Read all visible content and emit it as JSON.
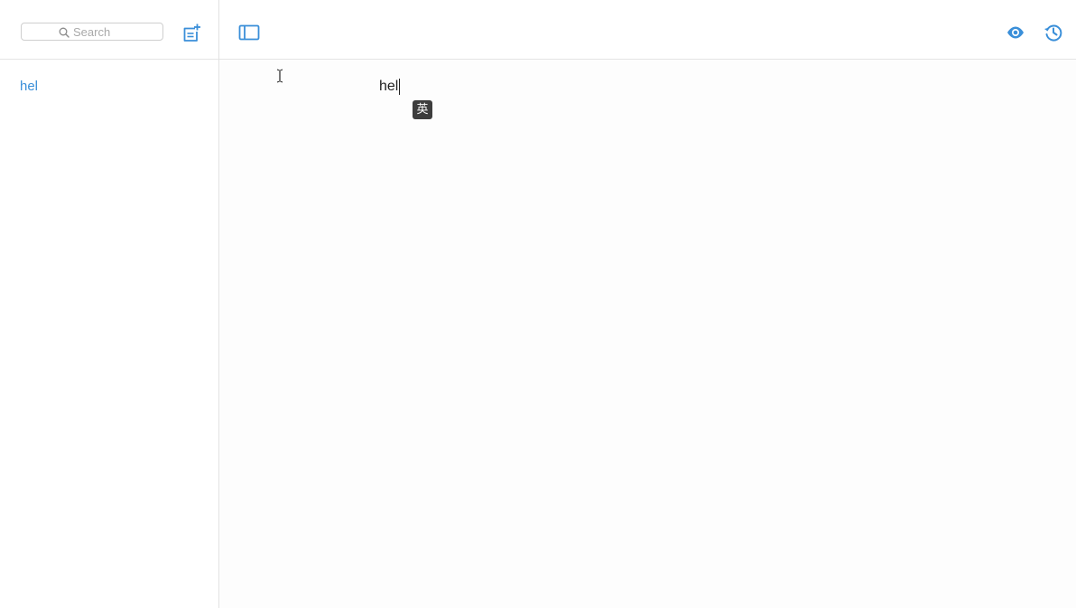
{
  "search": {
    "placeholder": "Search",
    "value": ""
  },
  "sidebar": {
    "notes": [
      {
        "title": "hel",
        "selected": true
      }
    ]
  },
  "toolbar": {
    "icons": {
      "new_note": "new-note-icon",
      "toggle_sidebar": "sidebar-toggle-icon",
      "preview": "eye-icon",
      "history": "history-icon"
    }
  },
  "editor": {
    "content": "hel",
    "ime_indicator": "英"
  },
  "colors": {
    "accent": "#3a8fd9",
    "ime_badge_bg": "#3d3d3d",
    "border": "#e4e4e4"
  }
}
